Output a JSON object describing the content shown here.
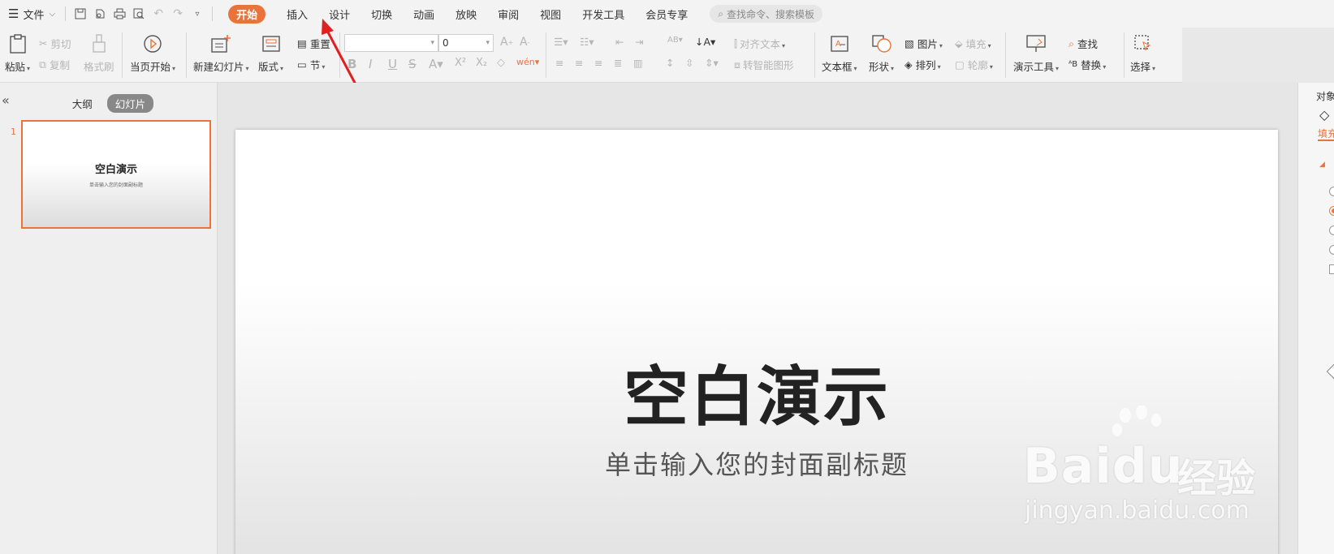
{
  "menu": {
    "file": "文件"
  },
  "tabs": [
    "开始",
    "插入",
    "设计",
    "切换",
    "动画",
    "放映",
    "审阅",
    "视图",
    "开发工具",
    "会员专享"
  ],
  "search": {
    "placeholder": "查找命令、搜索模板"
  },
  "ribbon": {
    "paste": "粘贴",
    "cut": "剪切",
    "copy": "复制",
    "format_painter": "格式刷",
    "play_from_current": "当页开始",
    "new_slide": "新建幻灯片",
    "layout": "版式",
    "reset": "重置",
    "section": "节",
    "font_size": "0",
    "align_text": "对齐文本",
    "smart_art": "转智能图形",
    "textbox": "文本框",
    "shapes": "形状",
    "picture": "图片",
    "arrange": "排列",
    "fill": "填充",
    "outline": "轮廓",
    "presenter_tools": "演示工具",
    "find": "查找",
    "replace": "替换",
    "select": "选择"
  },
  "left_pane": {
    "outline_tab": "大纲",
    "slides_tab": "幻灯片",
    "slide_number": "1",
    "thumb_title": "空白演示",
    "thumb_subtitle": "单击输入您的封面副标题"
  },
  "slide": {
    "title": "空白演示",
    "subtitle": "单击输入您的封面副标题"
  },
  "right_pane": {
    "header": "对象",
    "tab_fill": "填充"
  },
  "watermark": {
    "brand": "Baidu",
    "product": "经验",
    "url": "jingyan.baidu.com"
  },
  "colors": {
    "accent": "#e8743b",
    "arrow": "#e02020"
  }
}
